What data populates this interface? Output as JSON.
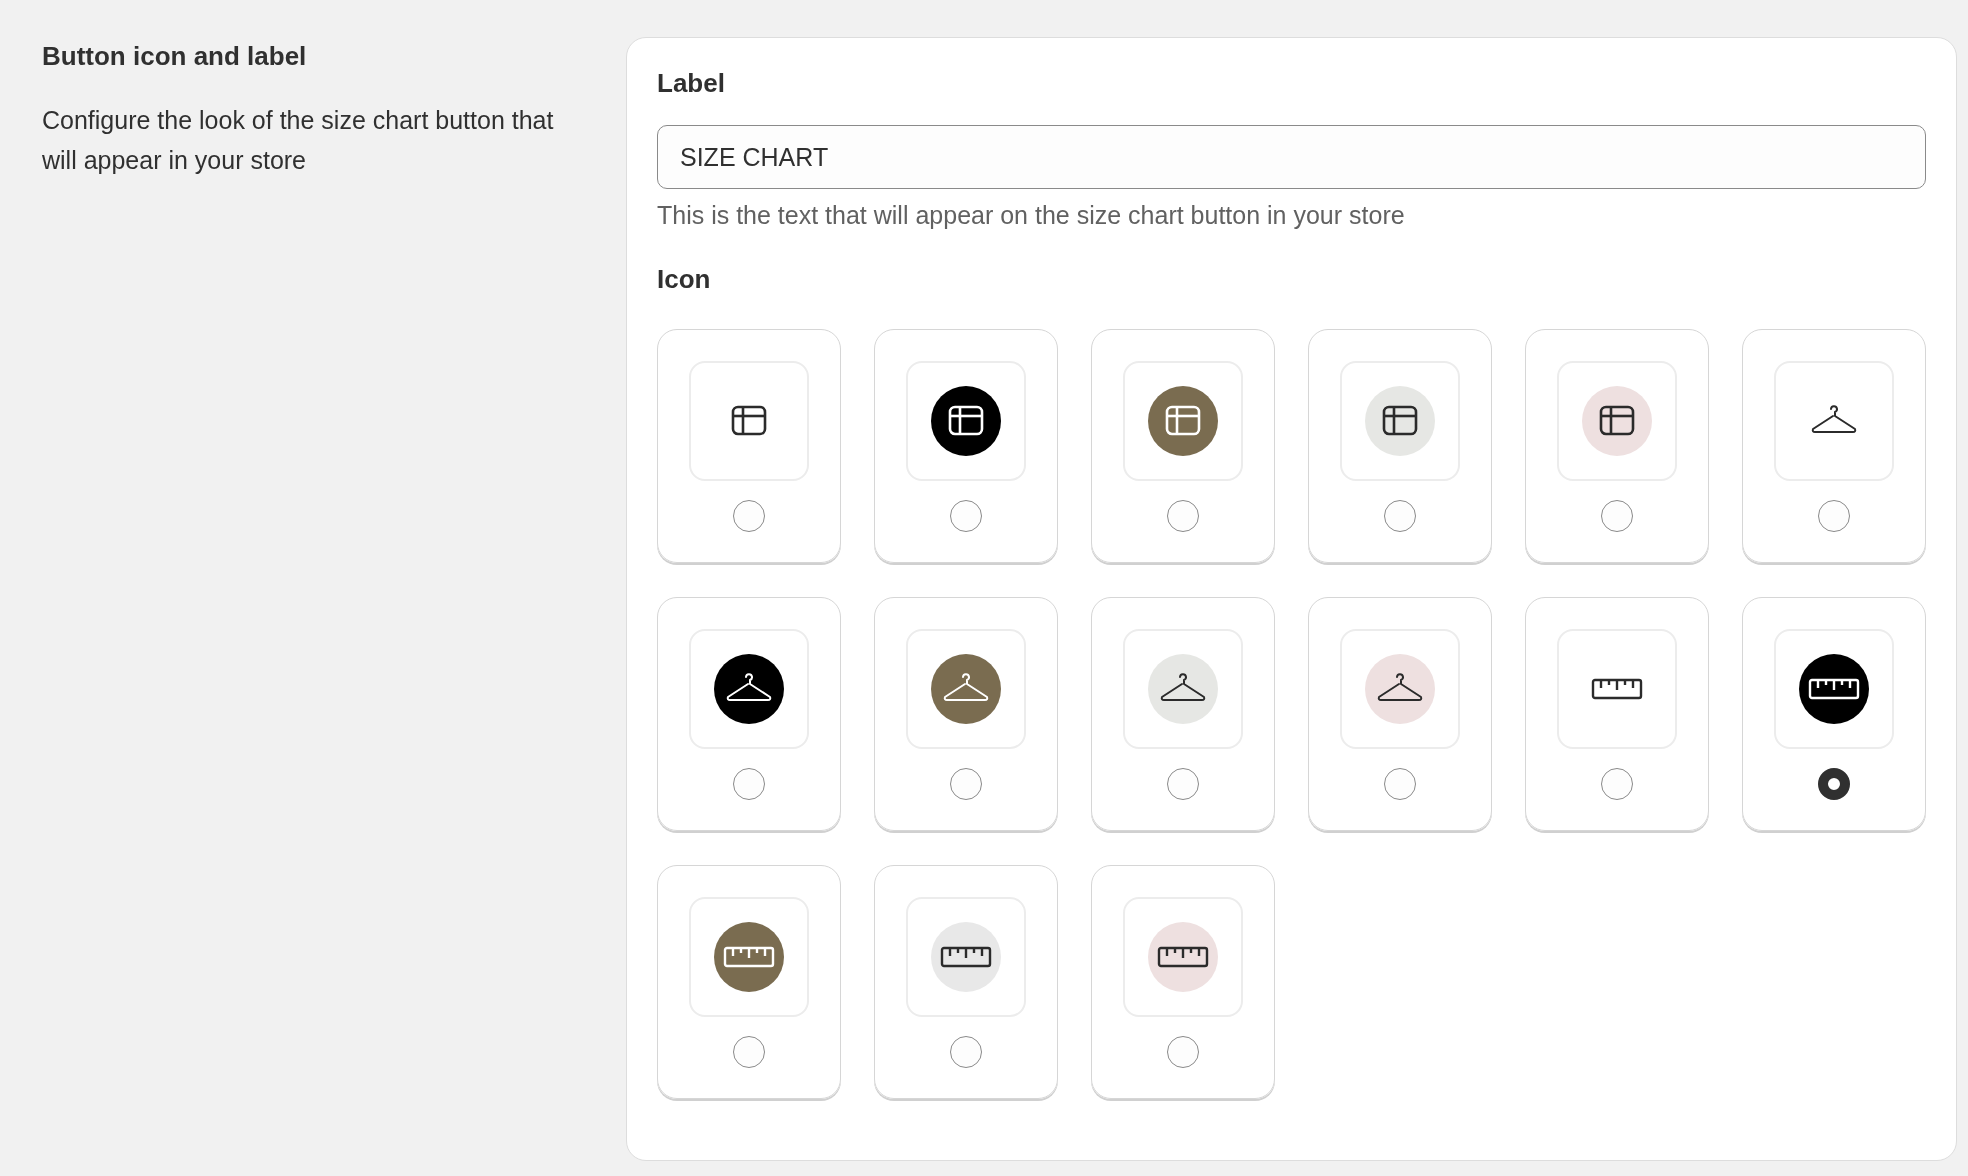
{
  "section": {
    "title": "Button icon and label",
    "description": "Configure the look of the size chart button that will appear in your store"
  },
  "label_field": {
    "heading": "Label",
    "value": "SIZE CHART",
    "help": "This is the text that will appear on the size chart button in your store"
  },
  "icon_picker": {
    "heading": "Icon",
    "options": [
      {
        "kind": "table",
        "selected": false
      },
      {
        "kind": "table",
        "color": "#000000",
        "selected": false
      },
      {
        "kind": "table",
        "color": "#7a6c50",
        "selected": false
      },
      {
        "kind": "table",
        "color": "#e6e7e4",
        "selected": false
      },
      {
        "kind": "table",
        "color": "#eee0e0",
        "selected": false
      },
      {
        "kind": "hanger",
        "selected": false
      },
      {
        "kind": "hanger",
        "color": "#000000",
        "selected": false
      },
      {
        "kind": "hanger",
        "color": "#7a6c50",
        "selected": false
      },
      {
        "kind": "hanger",
        "color": "#e6e7e4",
        "selected": false
      },
      {
        "kind": "hanger",
        "color": "#eee0e0",
        "selected": false
      },
      {
        "kind": "ruler",
        "selected": false
      },
      {
        "kind": "ruler",
        "color": "#000000",
        "selected": true
      },
      {
        "kind": "ruler",
        "color": "#7a6c50",
        "selected": false
      },
      {
        "kind": "ruler",
        "color": "#e8e8e8",
        "selected": false
      },
      {
        "kind": "ruler",
        "color": "#eee0e0",
        "selected": false
      }
    ]
  }
}
